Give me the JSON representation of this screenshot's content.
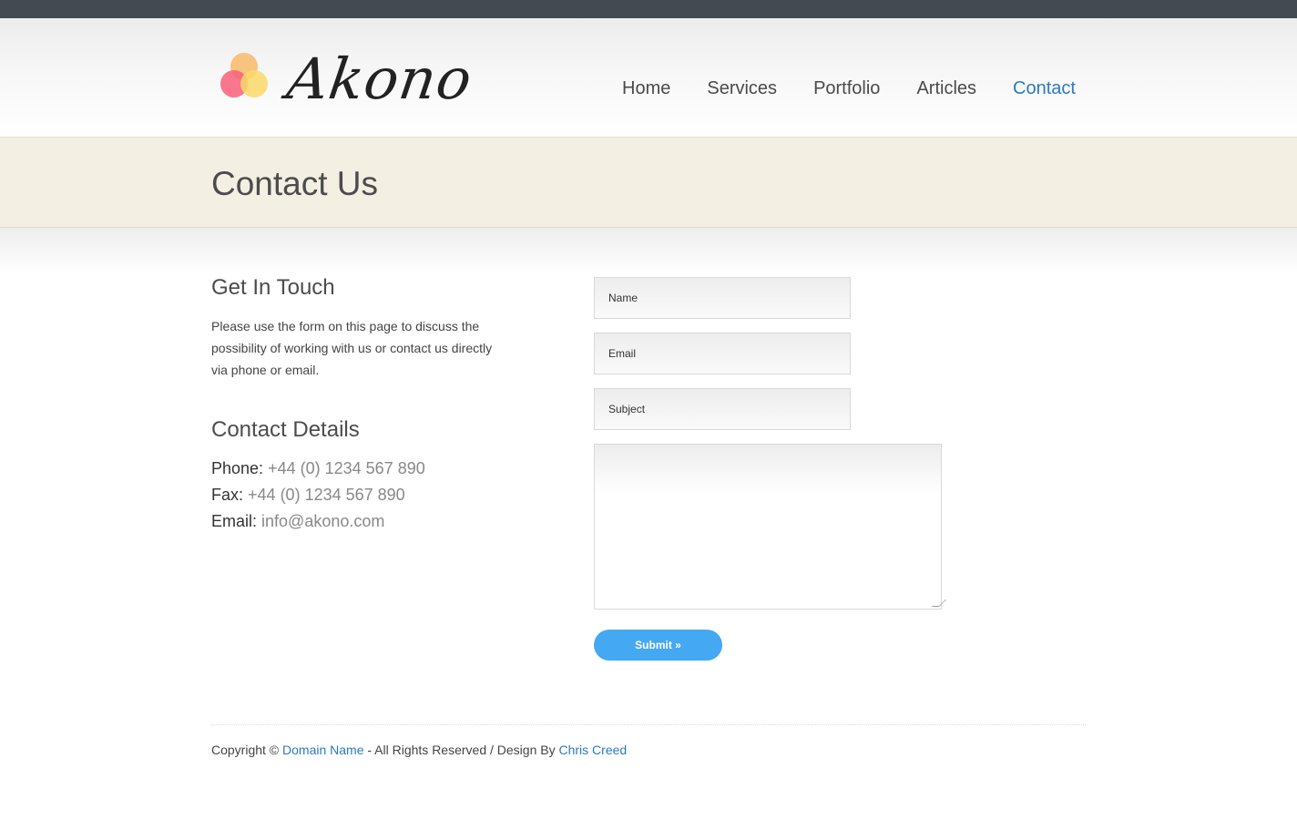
{
  "brand": {
    "name": "Akono",
    "logo_colors": [
      "#f8c07a",
      "#f8607a",
      "#fbd86a"
    ]
  },
  "nav": {
    "items": [
      {
        "label": "Home",
        "active": false
      },
      {
        "label": "Services",
        "active": false
      },
      {
        "label": "Portfolio",
        "active": false
      },
      {
        "label": "Articles",
        "active": false
      },
      {
        "label": "Contact",
        "active": true
      }
    ]
  },
  "page": {
    "title": "Contact Us"
  },
  "intro": {
    "heading": "Get In Touch",
    "text": "Please use the form on this page to discuss the possibility of working with us or contact us directly via phone or email."
  },
  "details": {
    "heading": "Contact Details",
    "phone_label": "Phone:",
    "phone_value": "+44 (0) 1234 567 890",
    "fax_label": "Fax:",
    "fax_value": "+44 (0) 1234 567 890",
    "email_label": "Email:",
    "email_value": "info@akono.com"
  },
  "form": {
    "name_placeholder": "Name",
    "email_placeholder": "Email",
    "subject_placeholder": "Subject",
    "message_value": "",
    "submit_label": "Submit »"
  },
  "footer": {
    "copyright": "Copyright ©",
    "domain_link": "Domain Name",
    "rights": "- All Rights Reserved / Design By",
    "designer_link": "Chris Creed"
  },
  "colors": {
    "accent": "#2a7ac0",
    "button": "#45a8f2",
    "banner": "#f3efe3",
    "topbar": "#434a52"
  }
}
